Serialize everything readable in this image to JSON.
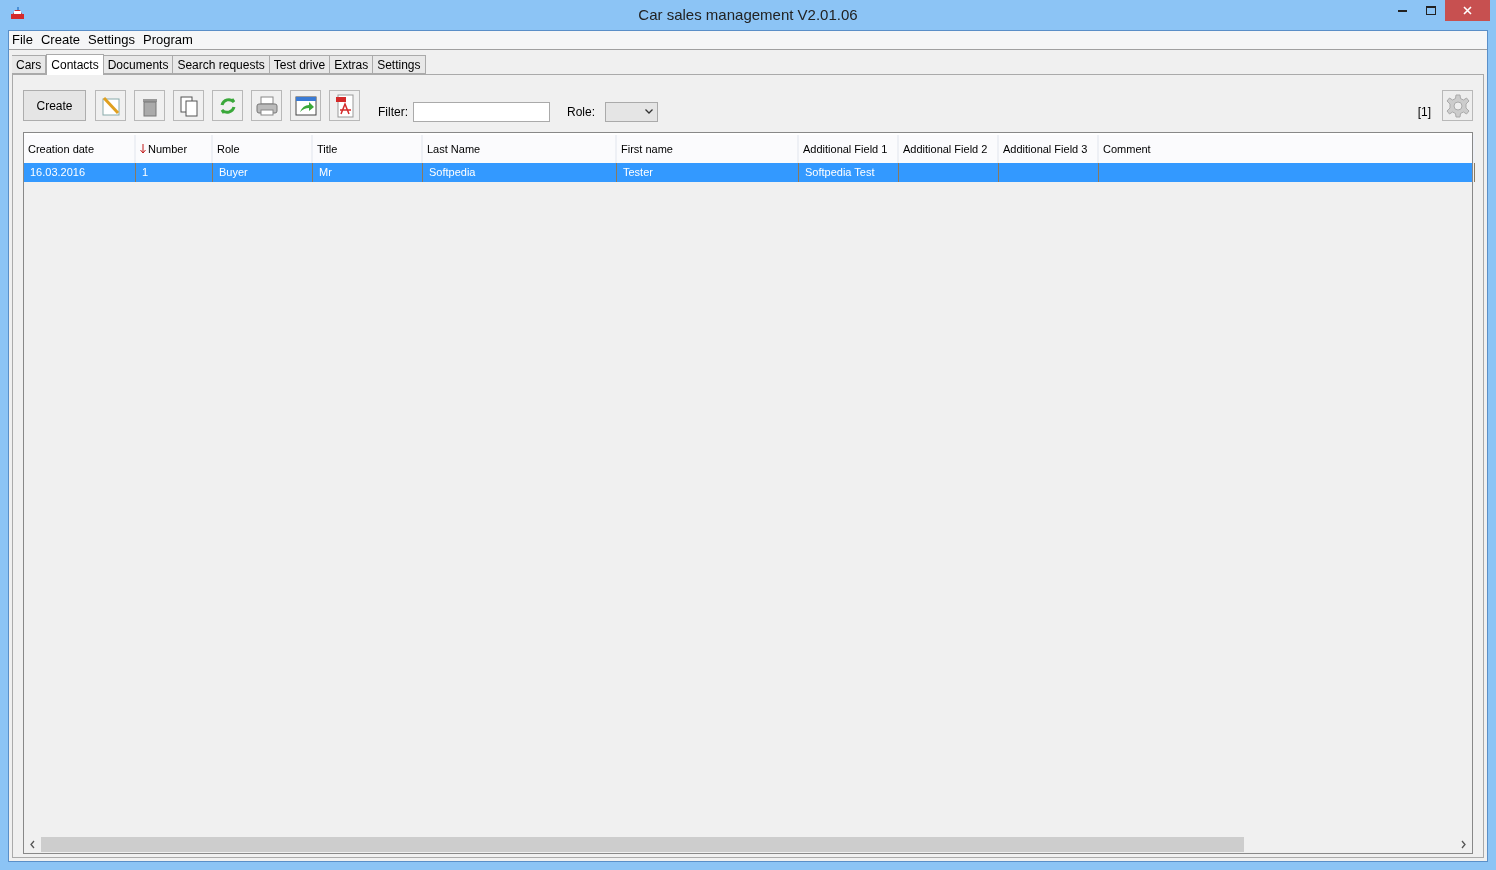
{
  "window": {
    "title": "Car sales management V2.01.06"
  },
  "menu": [
    "File",
    "Create",
    "Settings",
    "Program"
  ],
  "tabs": [
    {
      "label": "Cars",
      "selected": false
    },
    {
      "label": "Contacts",
      "selected": true
    },
    {
      "label": "Documents",
      "selected": false
    },
    {
      "label": "Search requests",
      "selected": false
    },
    {
      "label": "Test drive",
      "selected": false
    },
    {
      "label": "Extras",
      "selected": false
    },
    {
      "label": "Settings",
      "selected": false
    }
  ],
  "toolbar": {
    "create_button": "Create",
    "filter": {
      "label": "Filter:"
    },
    "role": {
      "label": "Role:"
    },
    "count": "[1]"
  },
  "table": {
    "columns": [
      {
        "label": "Creation date",
        "sorted": false
      },
      {
        "label": "Number",
        "sorted": true
      },
      {
        "label": "Role",
        "sorted": false
      },
      {
        "label": "Title",
        "sorted": false
      },
      {
        "label": "Last Name",
        "sorted": false
      },
      {
        "label": "First name",
        "sorted": false
      },
      {
        "label": "Additional Field 1",
        "sorted": false
      },
      {
        "label": "Additional Field 2",
        "sorted": false
      },
      {
        "label": "Additional Field 3",
        "sorted": false
      },
      {
        "label": "Comment",
        "sorted": false
      }
    ],
    "rows": [
      {
        "selected": true,
        "cells": [
          "16.03.2016",
          "1",
          "Buyer",
          "Mr",
          "Softpedia",
          "Tester",
          "Softpedia Test",
          "",
          "",
          ""
        ]
      }
    ]
  }
}
